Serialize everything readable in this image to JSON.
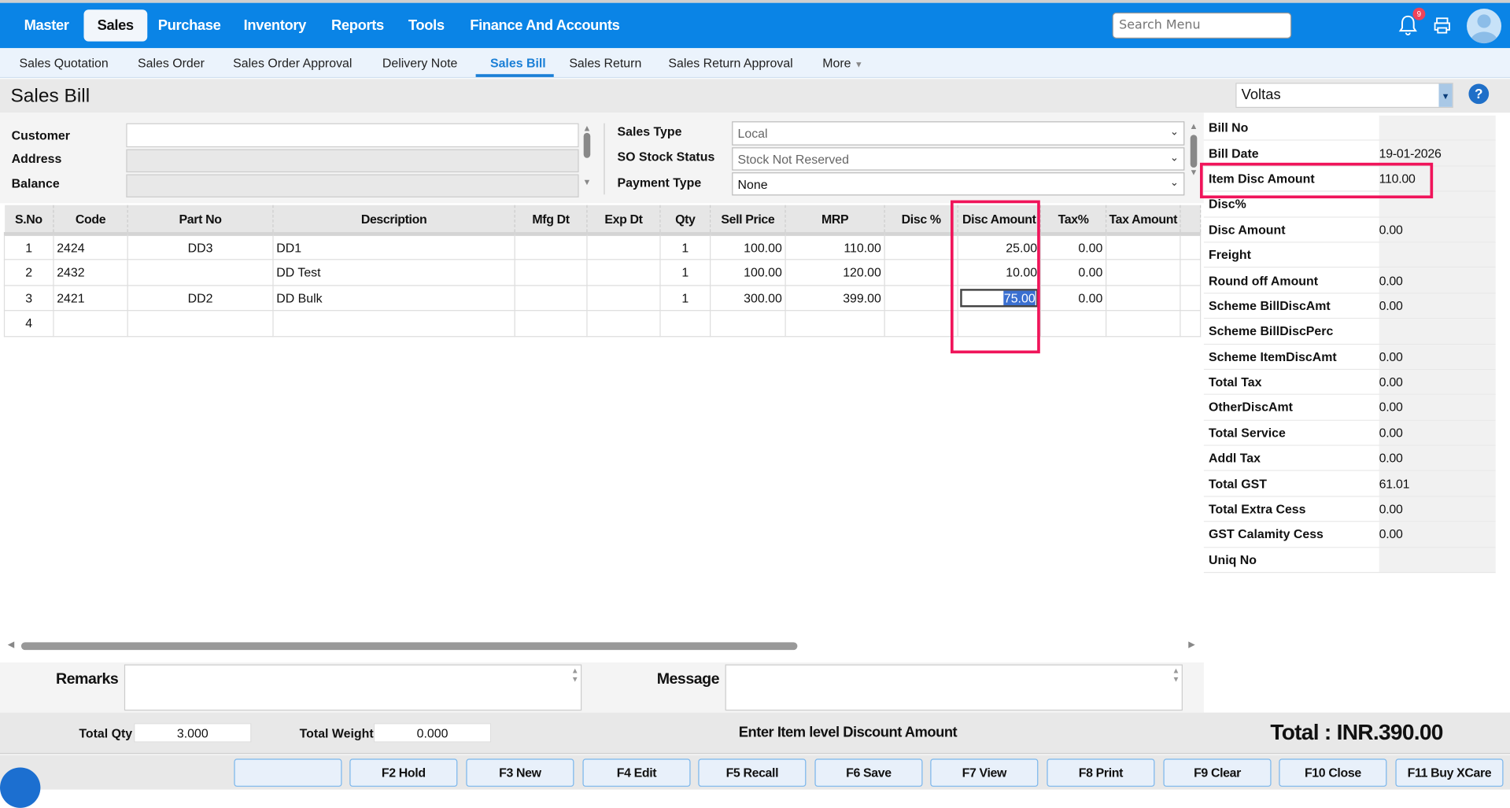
{
  "colors": {
    "nav_bg": "#0a84e6",
    "accent": "#1a7fd6",
    "highlight_box": "#f0145a"
  },
  "nav": {
    "items": [
      "Master",
      "Sales",
      "Purchase",
      "Inventory",
      "Reports",
      "Tools",
      "Finance And Accounts"
    ],
    "active": "Sales",
    "search_placeholder": "Search Menu",
    "notification_count": "9",
    "icons": [
      "bell-icon",
      "printer-icon",
      "avatar-icon"
    ]
  },
  "subnav": {
    "items": [
      "Sales Quotation",
      "Sales Order",
      "Sales Order Approval",
      "Delivery Note",
      "Sales Bill",
      "Sales Return",
      "Sales Return Approval",
      "More"
    ],
    "active": "Sales Bill"
  },
  "page": {
    "title": "Sales Bill",
    "company": "Voltas",
    "help": "?"
  },
  "header": {
    "customer_label": "Customer",
    "address_label": "Address",
    "balance_label": "Balance",
    "customer": "",
    "sales_type_label": "Sales Type",
    "sales_type": "Local",
    "so_stock_label": "SO Stock Status",
    "so_stock": "Stock Not Reserved",
    "payment_type_label": "Payment Type",
    "payment_type": "None"
  },
  "grid": {
    "columns": [
      "S.No",
      "Code",
      "Part No",
      "Description",
      "Mfg Dt",
      "Exp Dt",
      "Qty",
      "Sell Price",
      "MRP",
      "Disc %",
      "Disc Amount",
      "Tax%",
      "Tax Amount"
    ],
    "rows": [
      [
        "1",
        "2424",
        "DD3",
        "DD1",
        "",
        "",
        "1",
        "100.00",
        "110.00",
        "",
        "25.00",
        "0.00",
        ""
      ],
      [
        "2",
        "2432",
        "",
        "DD Test",
        "",
        "",
        "1",
        "100.00",
        "120.00",
        "",
        "10.00",
        "0.00",
        ""
      ],
      [
        "3",
        "2421",
        "DD2",
        "DD Bulk",
        "",
        "",
        "1",
        "300.00",
        "399.00",
        "",
        "75.00",
        "0.00",
        ""
      ],
      [
        "4",
        "",
        "",
        "",
        "",
        "",
        "",
        "",
        "",
        "",
        "",
        "",
        ""
      ]
    ]
  },
  "summary": [
    {
      "label": "Bill No",
      "value": ""
    },
    {
      "label": "Bill Date",
      "value": "19-01-2026"
    },
    {
      "label": "Item Disc Amount",
      "value": "110.00"
    },
    {
      "label": "Disc%",
      "value": ""
    },
    {
      "label": "Disc Amount",
      "value": "0.00"
    },
    {
      "label": "Freight",
      "value": ""
    },
    {
      "label": "Round off Amount",
      "value": "0.00"
    },
    {
      "label": "Scheme BillDiscAmt",
      "value": "0.00"
    },
    {
      "label": "Scheme BillDiscPerc",
      "value": ""
    },
    {
      "label": "Scheme ItemDiscAmt",
      "value": "0.00"
    },
    {
      "label": "Total Tax",
      "value": "0.00"
    },
    {
      "label": "OtherDiscAmt",
      "value": "0.00"
    },
    {
      "label": "Total Service",
      "value": "0.00"
    },
    {
      "label": "Addl Tax",
      "value": "0.00"
    },
    {
      "label": "Total GST",
      "value": "61.01"
    },
    {
      "label": "Total Extra Cess",
      "value": "0.00"
    },
    {
      "label": "GST Calamity Cess",
      "value": "0.00"
    },
    {
      "label": "Uniq No",
      "value": ""
    }
  ],
  "footer": {
    "remarks_label": "Remarks",
    "message_label": "Message",
    "total_qty_label": "Total Qty",
    "total_qty": "3.000",
    "total_weight_label": "Total Weight",
    "total_weight": "0.000",
    "status_message": "Enter Item level Discount Amount",
    "total": "Total : INR.390.00"
  },
  "buttons": [
    "",
    "F2 Hold",
    "F3 New",
    "F4 Edit",
    "F5 Recall",
    "F6 Save",
    "F7 View",
    "F8 Print",
    "F9 Clear",
    "F10 Close",
    "F11 Buy XCare"
  ]
}
